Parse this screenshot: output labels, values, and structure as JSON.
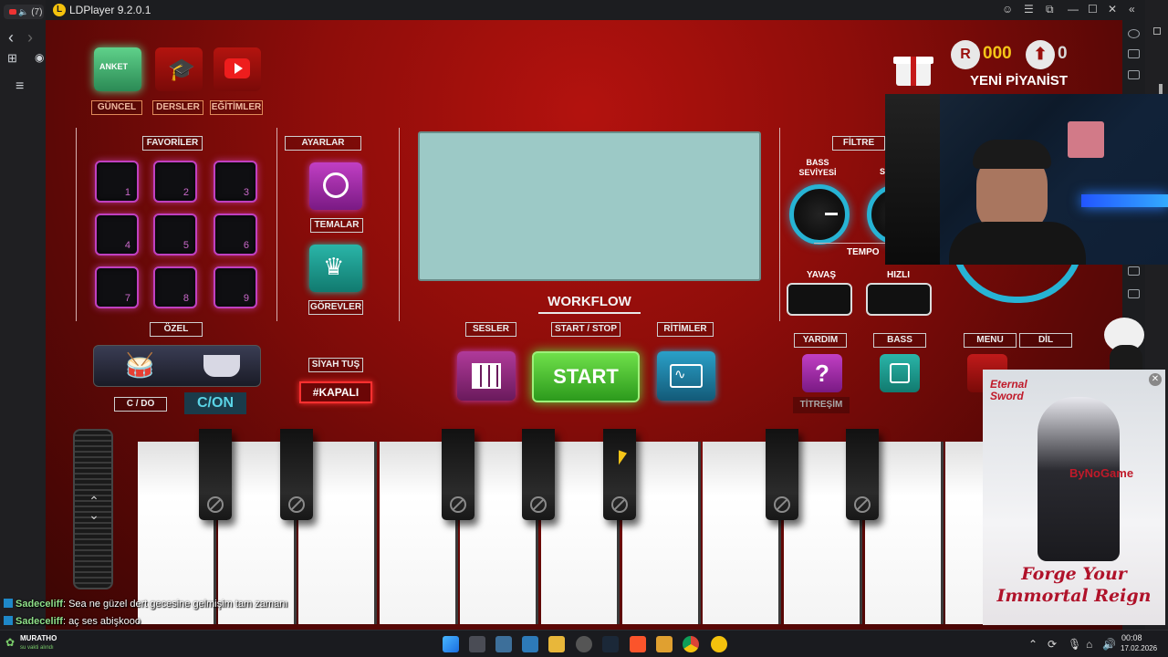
{
  "browser": {
    "tab_title": "(7)",
    "nav": {
      "back": "‹",
      "forward": "›"
    }
  },
  "emulator": {
    "title": "LDPlayer 9.2.0.1",
    "controls": [
      "☺",
      "☰",
      "⧉",
      "—",
      "☐",
      "✕",
      "«"
    ]
  },
  "game": {
    "top_icons": [
      {
        "name": "anket",
        "label": "GÜNCEL",
        "icon_text": "ANKET"
      },
      {
        "name": "dersler",
        "label": "DERSLER"
      },
      {
        "name": "egitimler",
        "label": "EĞİTİMLER"
      }
    ],
    "gift": {
      "coins": "000",
      "level": "0",
      "rank": "YENİ PİYANİST"
    },
    "favoriler": {
      "title": "FAVORİLER",
      "pads": [
        "1",
        "2",
        "3",
        "4",
        "5",
        "6",
        "7",
        "8",
        "9"
      ],
      "custom_label": "ÖZEL"
    },
    "ayarlar": {
      "title": "AYARLAR",
      "themes": "TEMALAR",
      "tasks": "GÖREVLER"
    },
    "filtre": {
      "title": "FİLTRE",
      "bass_level": "BASS SEVİYESİ",
      "bass_partial": "S",
      "tempo": "TEMPO",
      "slow": "YAVAŞ",
      "fast": "HIZLI"
    },
    "drums": {
      "c_do": "C / DO",
      "c_on": "C/ON"
    },
    "siyah_tus": {
      "title": "SİYAH TUŞ",
      "state": "#KAPALI"
    },
    "workflow": "WORKFLOW",
    "sesler": "SESLER",
    "start_stop": "START / STOP",
    "start": "START",
    "ritimler": "RİTİMLER",
    "yardim": {
      "title": "YARDIM",
      "help": "?",
      "vibration": "TİTREŞİM"
    },
    "bass": "BASS",
    "menu": "MENU",
    "dil": "DİL"
  },
  "overlay": {
    "ad": {
      "brand": "ByNoGame",
      "title": "Forge Your Immortal Reign",
      "logo_top": "Eternal",
      "logo_bottom": "Sword"
    }
  },
  "chat": [
    {
      "user": "Sadeceliff",
      "message": ": Sea ne güzel dert gecesine gelmişim tam zamanı"
    },
    {
      "user": "Sadeceliff",
      "message": ": aç ses abişkooo"
    }
  ],
  "taskbar": {
    "user": "MURATHO",
    "status": "su vakti alındı",
    "time": "00:08",
    "date": "17.02.2026"
  },
  "colors": {
    "accent_red": "#9a0f0c",
    "start_green": "#3fbf2a",
    "pad_purple": "#c040c0",
    "knob_cyan": "#27b3d4"
  }
}
